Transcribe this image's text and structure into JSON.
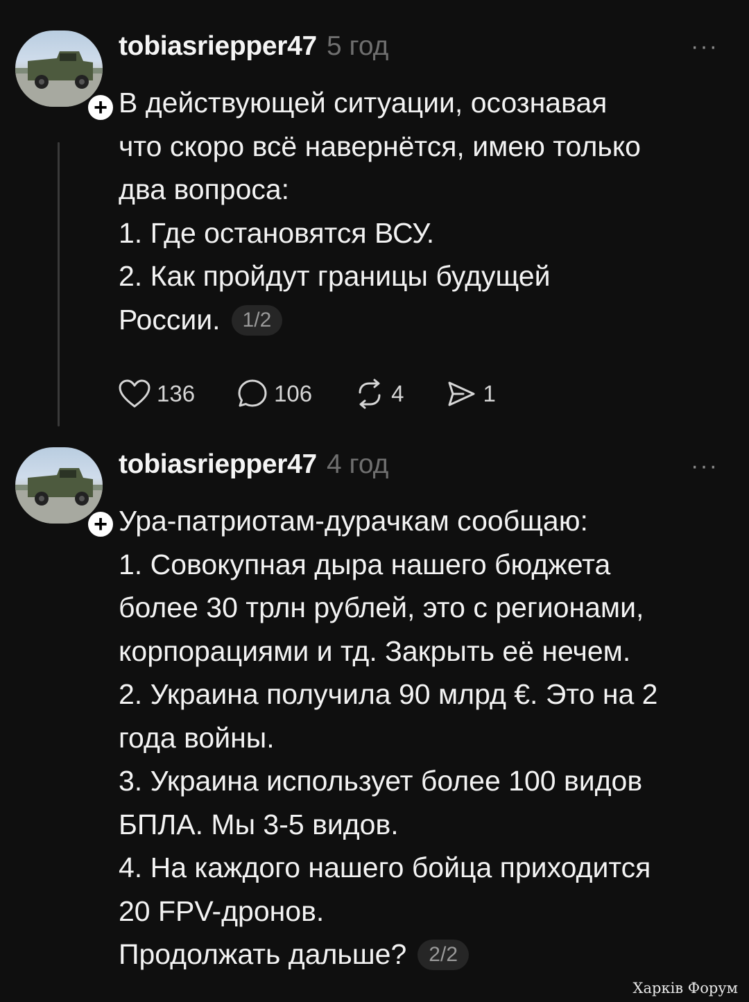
{
  "posts": [
    {
      "username": "tobiasriepper47",
      "time": "5 год",
      "more": "···",
      "lines": [
        "В действующей ситуации, осознавая",
        "что скоро всё навернётся, имею только",
        "два вопроса:",
        "1. Где остановятся  ВСУ.",
        "2. Как пройдут границы будущей",
        "России."
      ],
      "counter": "1/2",
      "actions": {
        "likes": "136",
        "replies": "106",
        "reposts": "4",
        "shares": "1"
      }
    },
    {
      "username": "tobiasriepper47",
      "time": "4 год",
      "more": "···",
      "lines": [
        "Ура-патриотам-дурачкам сообщаю:",
        "1. Совокупная дыра нашего бюджета",
        "более 30 трлн рублей, это с регионами,",
        "корпорациями и тд. Закрыть её нечем.",
        "2. Украина получила 90 млрд €. Это на 2",
        "года войны.",
        "3. Украина использует более 100 видов",
        "БПЛА. Мы 3-5 видов.",
        "4. На каждого нашего бойца приходится",
        "20 FPV-дронов.",
        "Продолжать дальше?"
      ],
      "counter": "2/2"
    }
  ],
  "follow_symbol": "+",
  "watermark": "Харків Форум",
  "icons": {
    "like": "heart-icon",
    "reply": "comment-icon",
    "repost": "repost-icon",
    "share": "share-icon",
    "more": "more-icon",
    "follow": "plus-icon"
  },
  "colors": {
    "background": "#0f0f0f",
    "text": "#f3f3f3",
    "muted": "#6f6f6f",
    "badge": "#262626"
  }
}
